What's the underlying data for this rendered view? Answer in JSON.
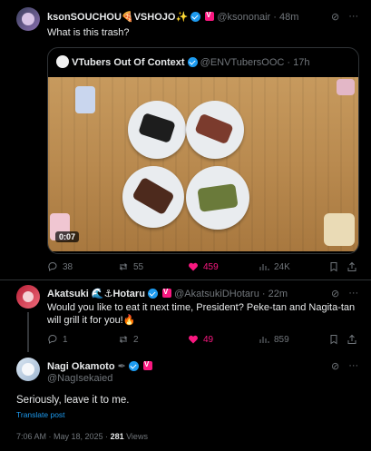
{
  "post1": {
    "display_name": "ksonSOUCHOU🍕VSHOJO✨",
    "handle": "@ksononair",
    "time": "· 48m",
    "text": "What is this trash?",
    "quote": {
      "display_name": "VTubers Out Of Context",
      "handle": "@ENVTubersOOC",
      "time": "· 17h",
      "video_duration": "0:07"
    },
    "stats": {
      "replies": "38",
      "reposts": "55",
      "likes": "459",
      "views": "24K"
    }
  },
  "post2": {
    "display_name": "Akatsuki 🌊⚓Hotaru",
    "handle": "@AkatsukiDHotaru",
    "time": "· 22m",
    "text": "Would you like to eat it next time, President? Peke-tan and Nagita-tan will grill it for you!🔥",
    "stats": {
      "replies": "1",
      "reposts": "2",
      "likes": "49",
      "views": "859"
    }
  },
  "post3": {
    "display_name": "Nagi Okamoto",
    "handle": "@NagIsekaied",
    "text": "Seriously, leave it to me.",
    "translate": "Translate post",
    "timestamp": "7:06 AM · May 18, 2025 · ",
    "views": "281",
    "views_label": " Views"
  },
  "colors": {
    "accent": "#1d9bf0",
    "like": "#f91880",
    "bg": "#000000"
  },
  "icons": [
    "more-icon",
    "grok-icon",
    "reply-icon",
    "repost-icon",
    "like-icon",
    "views-icon",
    "bookmark-icon",
    "share-icon"
  ]
}
